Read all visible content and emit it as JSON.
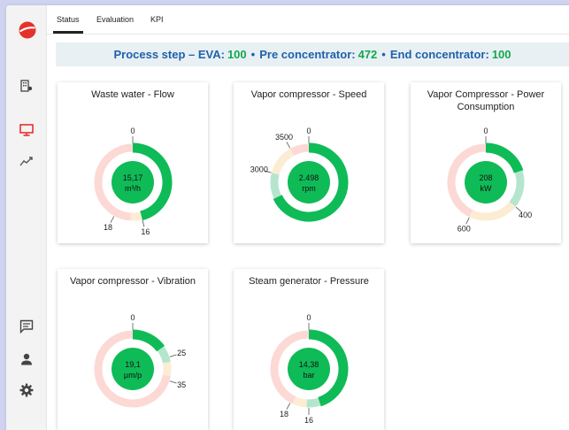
{
  "colors": {
    "accent": "#e53935",
    "green": "#0fbb57",
    "mint": "#b5e6cd",
    "cream": "#fdecd4",
    "pink": "#fcd9d5",
    "title_blue": "#1f61a9"
  },
  "tabs": [
    {
      "label": "Status",
      "active": true
    },
    {
      "label": "Evaluation",
      "active": false
    },
    {
      "label": "KPI",
      "active": false
    }
  ],
  "banner": {
    "prefix": "Process step – EVA:",
    "eva": "100",
    "sep1": "•",
    "pre_label": "Pre concentrator:",
    "pre": "472",
    "sep2": "•",
    "end_label": "End concentrator:",
    "end": "100"
  },
  "sidebar": {
    "icons": [
      "logo-icon",
      "building-icon",
      "monitor-icon",
      "trend-chart-icon",
      "chat-icon",
      "user-icon",
      "settings-gear-icon"
    ]
  },
  "gauges": [
    {
      "title": "Waste water - Flow",
      "value_line1": "15,17",
      "value_line2": "m³/h",
      "fill_fraction": 0.46,
      "segments": [
        {
          "from": 0,
          "to": 0.46,
          "color": "#b5e6cd"
        },
        {
          "from": 0.46,
          "to": 0.51,
          "color": "#fdecd4"
        },
        {
          "from": 0.51,
          "to": 1,
          "color": "#fcd9d5"
        }
      ],
      "labels": [
        {
          "text": "0",
          "at": 0
        },
        {
          "text": "16",
          "at": 0.46
        },
        {
          "text": "18",
          "at": 0.58
        }
      ]
    },
    {
      "title": "Vapor compressor - Speed",
      "value_line1": "2.498",
      "value_line2": "rpm",
      "fill_fraction": 0.68,
      "segments": [
        {
          "from": 0,
          "to": 0.68,
          "color": "#b5e6cd"
        },
        {
          "from": 0.68,
          "to": 0.79,
          "color": "#b5e6cd"
        },
        {
          "from": 0.79,
          "to": 0.92,
          "color": "#fdecd4"
        },
        {
          "from": 0.92,
          "to": 1,
          "color": "#fcd9d5"
        }
      ],
      "labels": [
        {
          "text": "0",
          "at": 0
        },
        {
          "text": "3000",
          "at": 0.79
        },
        {
          "text": "3500",
          "at": 0.92
        }
      ]
    },
    {
      "title": "Vapor Compressor - Power Consumption",
      "value_line1": "208",
      "value_line2": "kW",
      "fill_fraction": 0.2,
      "segments": [
        {
          "from": 0,
          "to": 0.2,
          "color": "#b5e6cd"
        },
        {
          "from": 0.2,
          "to": 0.36,
          "color": "#b5e6cd"
        },
        {
          "from": 0.36,
          "to": 0.57,
          "color": "#fdecd4"
        },
        {
          "from": 0.57,
          "to": 1,
          "color": "#fcd9d5"
        }
      ],
      "labels": [
        {
          "text": "0",
          "at": 0
        },
        {
          "text": "400",
          "at": 0.36
        },
        {
          "text": "600",
          "at": 0.57
        }
      ]
    },
    {
      "title": "Vapor compressor - Vibration",
      "value_line1": "19,1",
      "value_line2": "µm/p",
      "fill_fraction": 0.15,
      "segments": [
        {
          "from": 0,
          "to": 0.15,
          "color": "#b5e6cd"
        },
        {
          "from": 0.15,
          "to": 0.22,
          "color": "#b5e6cd"
        },
        {
          "from": 0.22,
          "to": 0.28,
          "color": "#fdecd4"
        },
        {
          "from": 0.28,
          "to": 1,
          "color": "#fcd9d5"
        }
      ],
      "labels": [
        {
          "text": "0",
          "at": 0
        },
        {
          "text": "25",
          "at": 0.2
        },
        {
          "text": "35",
          "at": 0.3
        }
      ]
    },
    {
      "title": "Steam generator - Pressure",
      "value_line1": "14,38",
      "value_line2": "bar",
      "fill_fraction": 0.45,
      "segments": [
        {
          "from": 0,
          "to": 0.45,
          "color": "#b5e6cd"
        },
        {
          "from": 0.45,
          "to": 0.51,
          "color": "#b5e6cd"
        },
        {
          "from": 0.51,
          "to": 0.57,
          "color": "#fdecd4"
        },
        {
          "from": 0.57,
          "to": 1,
          "color": "#fcd9d5"
        }
      ],
      "labels": [
        {
          "text": "0",
          "at": 0
        },
        {
          "text": "16",
          "at": 0.5
        },
        {
          "text": "18",
          "at": 0.58
        }
      ]
    }
  ]
}
